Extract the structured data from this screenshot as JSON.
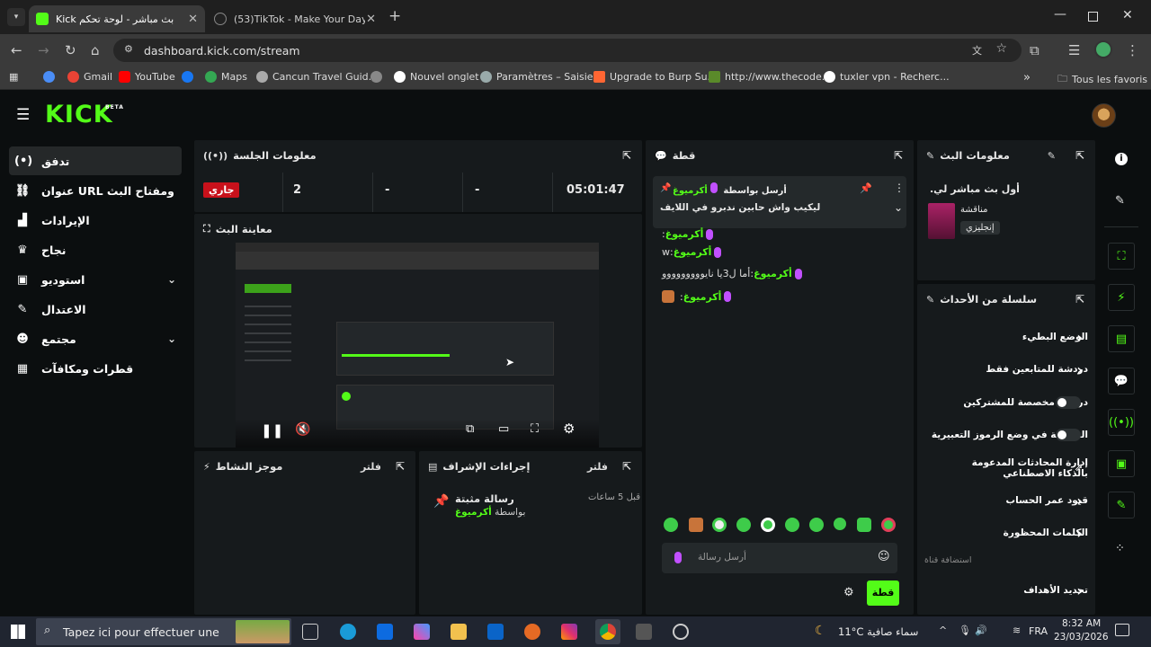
{
  "browser": {
    "tabs": [
      {
        "title": "بث مباشر - لوحة تحكم Kick",
        "active": true
      },
      {
        "title": "(53)TikTok - Make Your Day",
        "active": false
      }
    ],
    "new_tab": "+",
    "url": "dashboard.kick.com/stream",
    "bookmarks": [
      "Gmail",
      "YouTube",
      "Maps",
      "Cancun Travel Guid...",
      "Nouvel onglet",
      "Paramètres – Saisie...",
      "Upgrade to Burp Su...",
      "http://www.thecode...",
      "tuxler vpn - Recherc..."
    ],
    "bookmarks_overflow": "»",
    "all_favorites": "Tous les favoris"
  },
  "kick": {
    "logo": "KICK",
    "logo_tag": "BETA",
    "nav": [
      {
        "label": "تدفق",
        "icon": "(•)"
      },
      {
        "label": "عنوان URL ومفتاح البث",
        "icon": "🔗"
      },
      {
        "label": "الإيرادات",
        "icon": "▮"
      },
      {
        "label": "نجاح",
        "icon": "🏆"
      },
      {
        "label": "استوديو",
        "icon": "▣"
      },
      {
        "label": "الاعتدال",
        "icon": "✎"
      },
      {
        "label": "مجتمع",
        "icon": "☻"
      },
      {
        "label": "قطرات ومكافآت",
        "icon": "▦"
      }
    ],
    "session": {
      "title": "معلومات الجلسة",
      "status": "جاري",
      "viewers": "2",
      "stat2": "-",
      "stat3": "-",
      "duration": "05:01:47"
    },
    "preview": {
      "title": "معاينة البث"
    },
    "activity": {
      "title": "موجز النشاط",
      "filter": "فلتر"
    },
    "modactions": {
      "title": "إجراءات الإشراف",
      "filter": "فلتر",
      "entry_title": "رسالة مثبتة",
      "entry_by": "بواسطة",
      "entry_user": "أكرميوغ",
      "entry_time": "قبل 5 ساعات"
    },
    "chat": {
      "title": "قطة",
      "pinned_prefix": "أرسل بواسطة",
      "pinned_user": "أكرميوغ",
      "pinned_text": "ليكيب واش حابين ندبرو في اللايف",
      "messages": [
        {
          "user": "أكرميوغ",
          "text": ""
        },
        {
          "user": "أكرميوغ",
          "text": "w"
        },
        {
          "user": "أكرميوغ",
          "text": "أما ل3يا نايووووووووو"
        },
        {
          "user": "أكرميوغ",
          "text": ""
        }
      ],
      "input_placeholder": "أرسل رسالة",
      "send": "قطة"
    },
    "stream_info": {
      "title": "معلومات البث",
      "stream_title": "أول بث مباشر لي.",
      "category": "مناقشة",
      "language": "إنجليزي"
    },
    "events": {
      "title": "سلسلة من الأحداث",
      "items": [
        {
          "label": "الوضع البطيء",
          "type": "chevron"
        },
        {
          "label": "دردشة للمتابعين فقط",
          "type": "chevron"
        },
        {
          "label": "دردشة مخصصة للمشتركين",
          "type": "toggle"
        },
        {
          "label": "الدردشة في وضع الرموز التعبيرية",
          "type": "toggle"
        },
        {
          "label": "إدارة المحادثات المدعومة بالذكاء الاصطناعي",
          "type": "external"
        },
        {
          "label": "قيود عمر الحساب",
          "type": "chevron"
        },
        {
          "label": "الكلمات المحظورة",
          "type": "chevron"
        }
      ],
      "section": "استضافة قناة",
      "goals": "تحديد الأهداف"
    }
  },
  "taskbar": {
    "search_placeholder": "Tapez ici pour effectuer une",
    "weather": "11°C  سماء صافية",
    "lang": "FRA",
    "time": "8:32 AM",
    "date": "23/03/2026"
  },
  "colors": {
    "accent": "#53fc18",
    "live": "#c8111b",
    "panel": "#161a1c",
    "bg": "#0b0e0f"
  }
}
